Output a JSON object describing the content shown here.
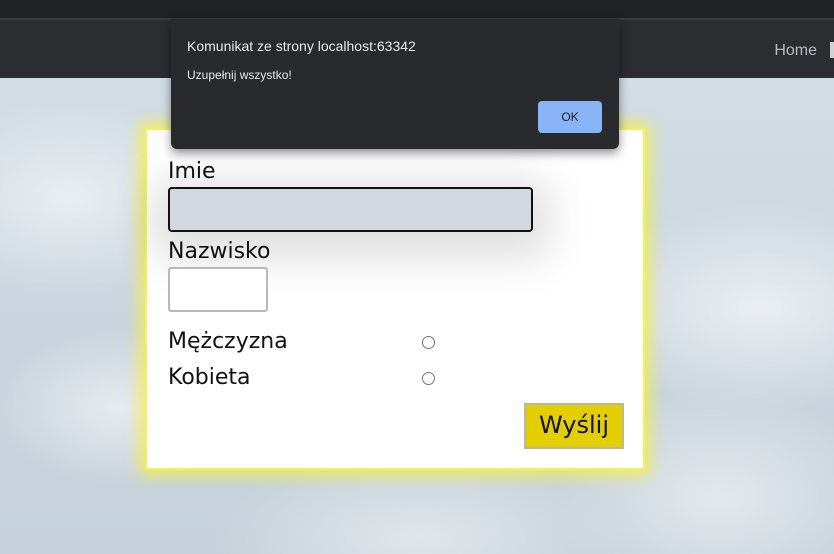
{
  "nav": {
    "home_label": "Home"
  },
  "dialog": {
    "title": "Komunikat ze strony localhost:63342",
    "message": "Uzupełnij wszystko!",
    "ok_label": "OK"
  },
  "form": {
    "first_name_label": "Imie",
    "first_name_value": "",
    "last_name_label": "Nazwisko",
    "last_name_value": "",
    "gender_options": [
      {
        "label": "Mężczyzna",
        "selected": false
      },
      {
        "label": "Kobieta",
        "selected": false
      }
    ],
    "submit_label": "Wyślij"
  },
  "colors": {
    "navbar": "#2b2d30",
    "card_glow": "#f4f25a",
    "submit_bg": "#e3cf00",
    "dialog_bg": "#292a2d",
    "ok_button": "#8ab4f8"
  }
}
